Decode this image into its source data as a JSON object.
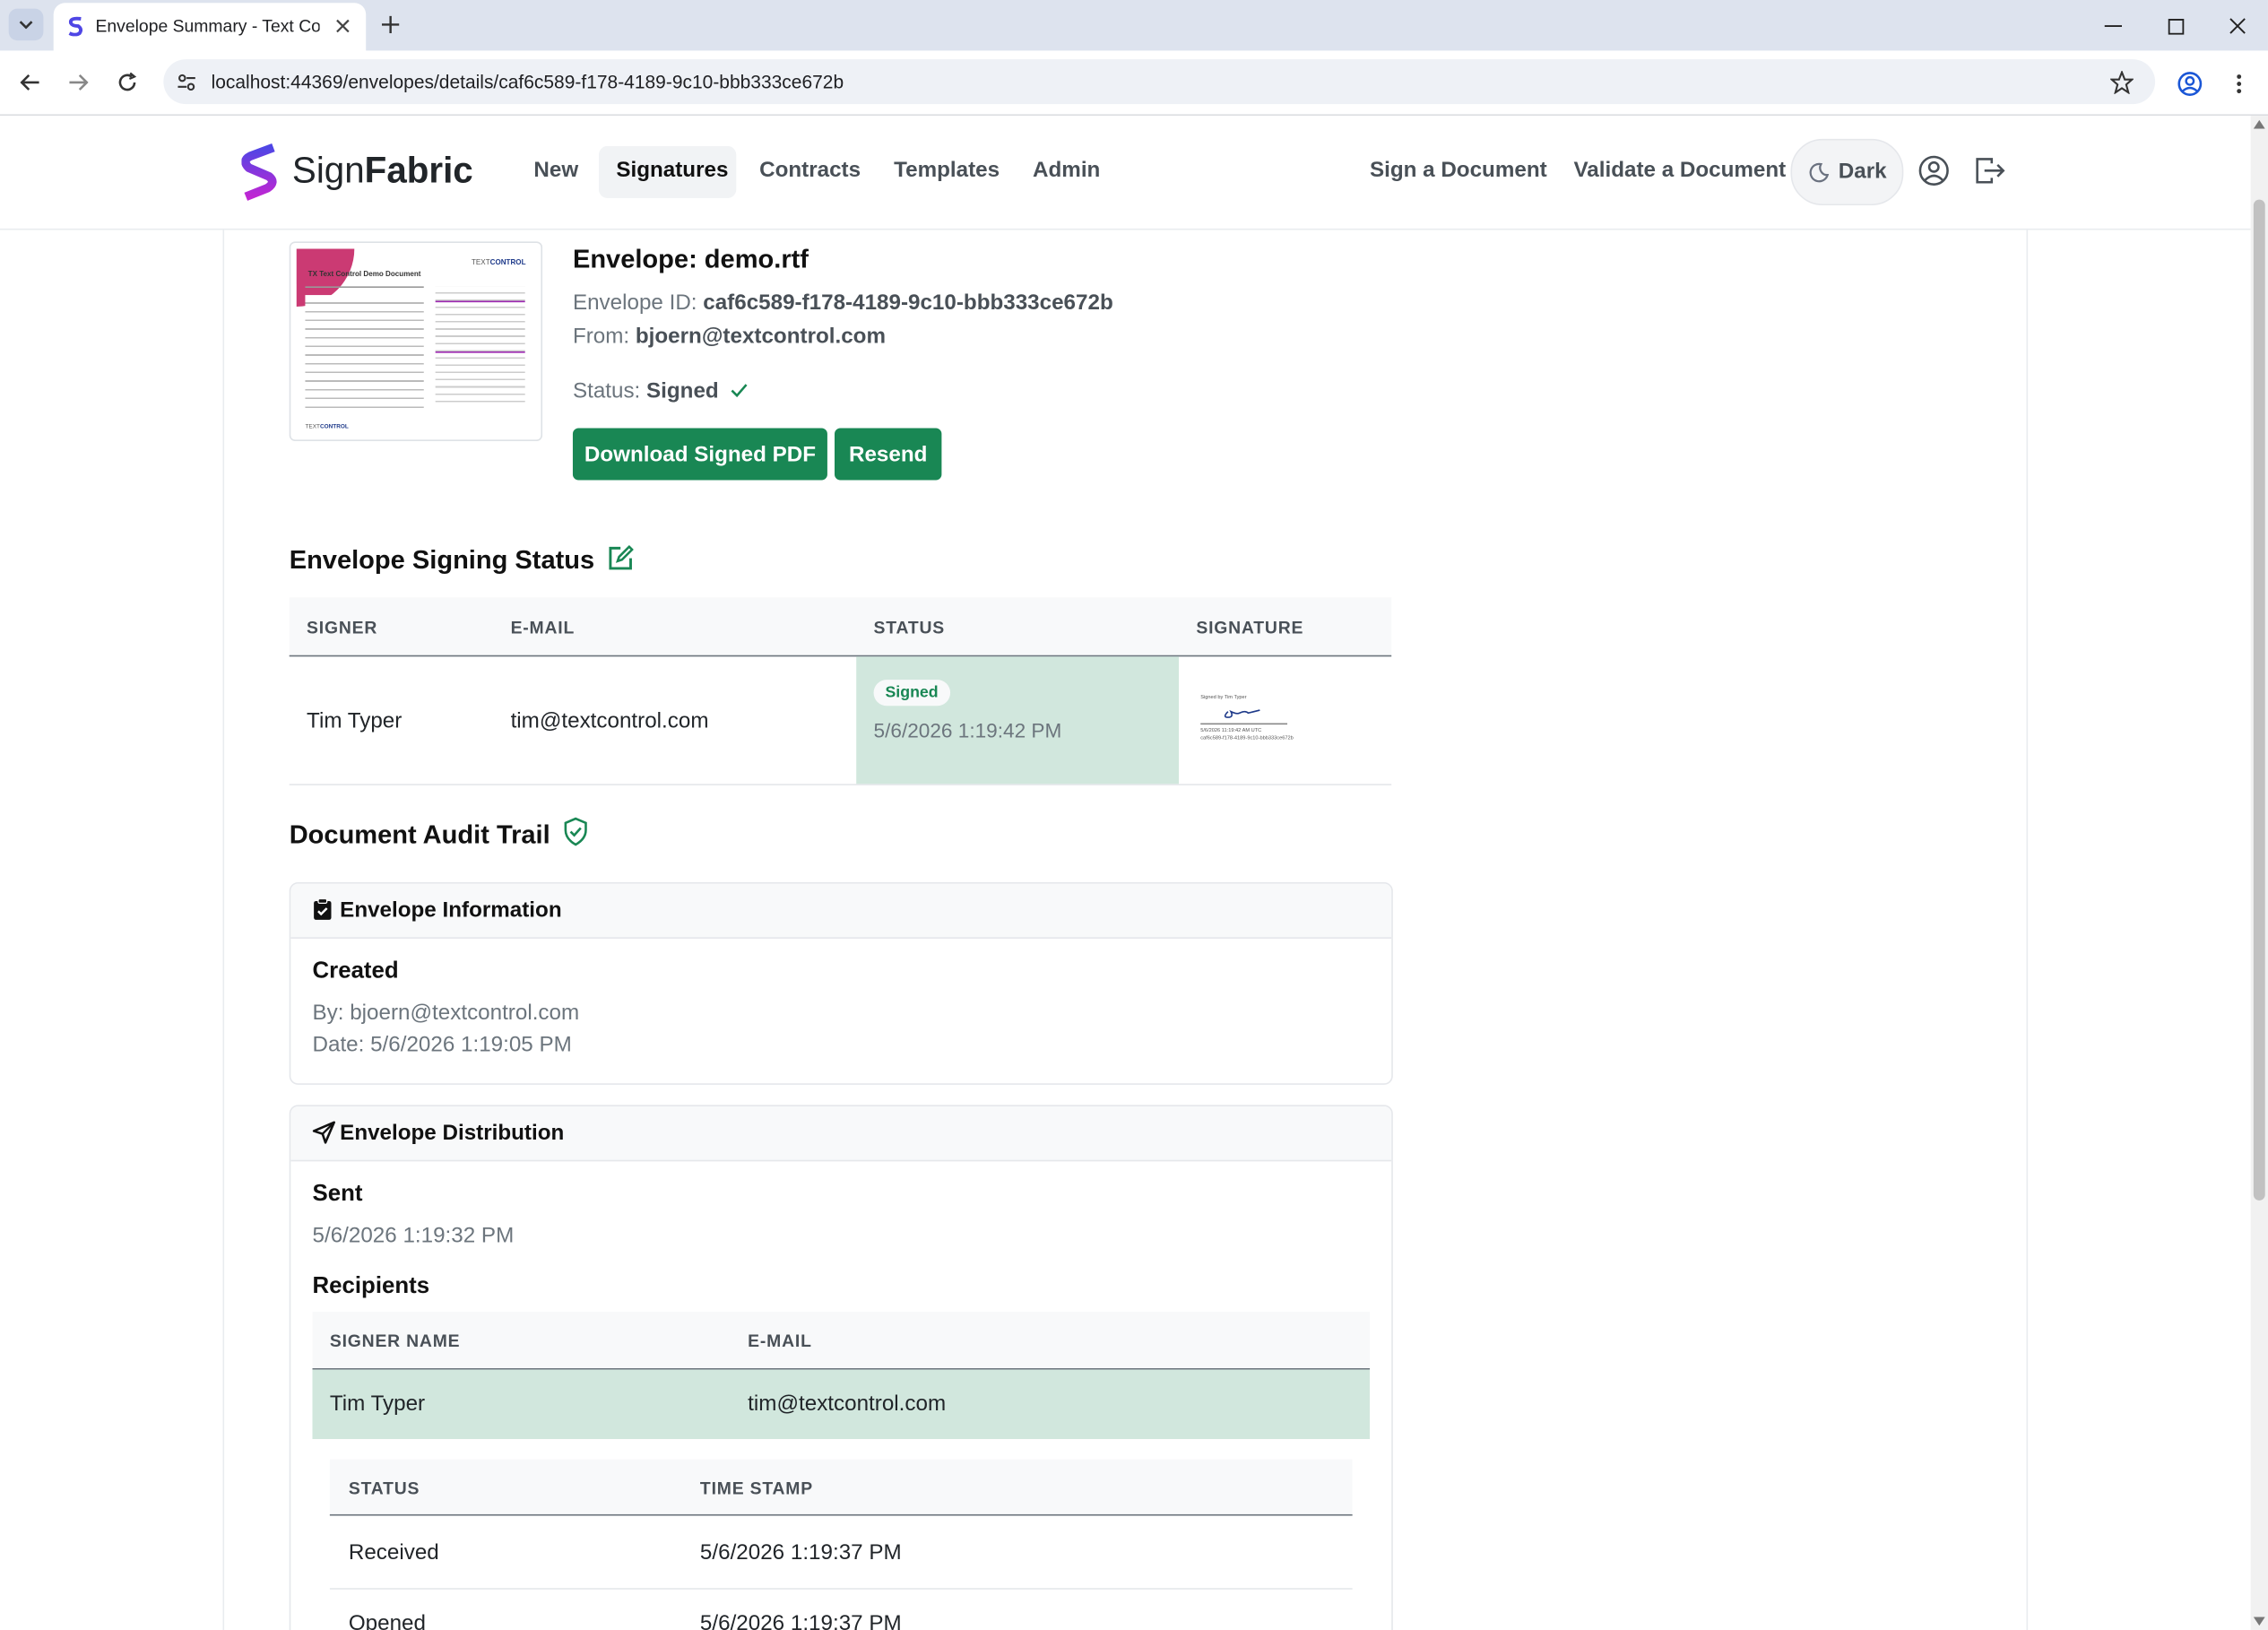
{
  "browser": {
    "tab_title": "Envelope Summary - Text Control",
    "url": "localhost:44369/envelopes/details/caf6c589-f178-4189-9c10-bbb333ce672b"
  },
  "nav": {
    "brand_sign": "Sign",
    "brand_fabric": "Fabric",
    "links": [
      "New",
      "Signatures",
      "Contracts",
      "Templates",
      "Admin"
    ],
    "right_links": [
      "Sign a Document",
      "Validate a Document"
    ],
    "theme_label": "Dark"
  },
  "envelope": {
    "title": "Envelope: demo.rtf",
    "id_label": "Envelope ID: ",
    "id_value": "caf6c589-f178-4189-9c10-bbb333ce672b",
    "from_label": "From: ",
    "from_value": "bjoern@textcontrol.com",
    "status_label": "Status: ",
    "status_value": "Signed",
    "download_button": "Download Signed PDF",
    "resend_button": "Resend",
    "thumb_title": "TX Text Control Demo Document",
    "thumb_logo_text": "TEXT",
    "thumb_logo_strong": "CONTROL"
  },
  "signing_status": {
    "heading": "Envelope Signing Status",
    "columns": [
      "SIGNER",
      "E-MAIL",
      "STATUS",
      "SIGNATURE"
    ],
    "row": {
      "signer": "Tim Typer",
      "email": "tim@textcontrol.com",
      "badge": "Signed",
      "date": "5/6/2026 1:19:42 PM",
      "sig_caption": "Signed by Tim Typer",
      "sig_line1": "5/6/2026 11:19:42 AM UTC",
      "sig_line2": "caf6c589-f178-4189-9c10-bbb333ce672b"
    }
  },
  "audit": {
    "heading": "Document Audit Trail",
    "info_card": {
      "title": "Envelope Information",
      "created_heading": "Created",
      "by": "By: bjoern@textcontrol.com",
      "date": "Date: 5/6/2026 1:19:05 PM"
    },
    "dist_card": {
      "title": "Envelope Distribution",
      "sent_heading": "Sent",
      "sent_date": "5/6/2026 1:19:32 PM",
      "recipients_heading": "Recipients",
      "columns": [
        "SIGNER NAME",
        "E-MAIL"
      ],
      "recipient": {
        "name": "Tim Typer",
        "email": "tim@textcontrol.com"
      },
      "status_columns": [
        "STATUS",
        "TIME STAMP"
      ],
      "events": [
        {
          "status": "Received",
          "time": "5/6/2026 1:19:37 PM"
        },
        {
          "status": "Opened",
          "time": "5/6/2026 1:19:37 PM"
        }
      ]
    }
  },
  "colors": {
    "accent_green": "#198754",
    "signed_cell_bg": "#d1e7dd",
    "brand_gradient_top": "#4f46e5",
    "brand_gradient_bottom": "#c026d3"
  }
}
